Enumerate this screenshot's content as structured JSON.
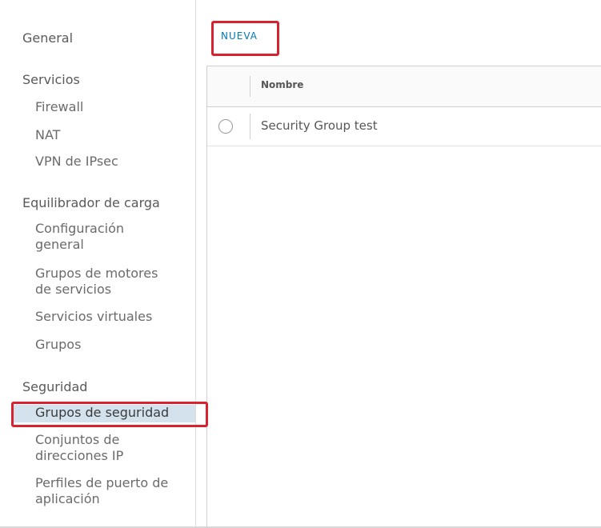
{
  "sidebar": {
    "general": "General",
    "services_title": "Servicios",
    "services": [
      {
        "label": "Firewall"
      },
      {
        "label": "NAT"
      },
      {
        "label": "VPN de IPsec"
      }
    ],
    "lb_title": "Equilibrador de carga",
    "lb_items": [
      {
        "label": "Configuración\ngeneral"
      },
      {
        "label": "Grupos de motores\nde servicios"
      },
      {
        "label": "Servicios virtuales"
      },
      {
        "label": "Grupos"
      }
    ],
    "security_title": "Seguridad",
    "security_items": [
      {
        "label": "Grupos de seguridad",
        "active": true
      },
      {
        "label": "Conjuntos de\ndirecciones IP"
      },
      {
        "label": "Perfiles de puerto de\naplicación"
      }
    ]
  },
  "toolbar": {
    "new_label": "NUEVA"
  },
  "table": {
    "columns": [
      "Nombre"
    ],
    "rows": [
      {
        "name": "Security Group test",
        "selected": false
      }
    ]
  },
  "colors": {
    "accent": "#0079b8",
    "active_bg": "#d4e2ed",
    "highlight": "#d6232f"
  }
}
